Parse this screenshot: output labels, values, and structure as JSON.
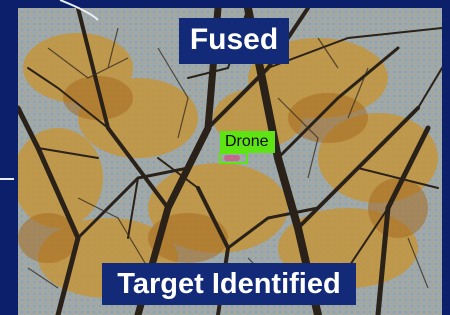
{
  "overlay": {
    "mode_label": "Fused",
    "status_label": "Target Identified"
  },
  "detection": {
    "class_label": "Drone",
    "box_color": "#5ee414"
  },
  "colors": {
    "frame": "#0b1f6b",
    "badge": "#122a78",
    "text": "#ffffff"
  }
}
